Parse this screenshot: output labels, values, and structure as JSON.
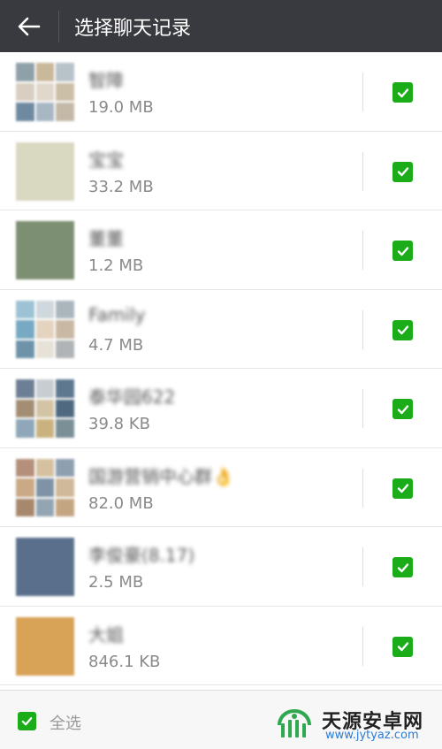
{
  "header": {
    "title": "选择聊天记录"
  },
  "chats": [
    {
      "name": "智障",
      "size": "19.0 MB",
      "checked": true,
      "grid": 3,
      "colors": [
        "#8fa0a8",
        "#c9b89a",
        "#b7c2c9",
        "#d8cfc2",
        "#e0d8cc",
        "#cbbfa8",
        "#6f8aa0",
        "#a7b7c3",
        "#c4b9a7"
      ]
    },
    {
      "name": "宝宝",
      "size": "33.2 MB",
      "checked": true,
      "grid": 1,
      "colors": [
        "#d9d8c1"
      ]
    },
    {
      "name": "董董",
      "size": "1.2 MB",
      "checked": true,
      "grid": 1,
      "colors": [
        "#7d8f72"
      ]
    },
    {
      "name": "Family",
      "size": "4.7 MB",
      "checked": true,
      "grid": 3,
      "colors": [
        "#9dc2d4",
        "#cfd8dc",
        "#aab6bc",
        "#77a9c2",
        "#e3d3bf",
        "#c9b8a4",
        "#6e93a8",
        "#e6e2d8",
        "#b0b4b6"
      ]
    },
    {
      "name": "泰华园622",
      "size": "39.8 KB",
      "checked": true,
      "grid": 3,
      "colors": [
        "#6c7f95",
        "#c8cdd2",
        "#5e7890",
        "#a38e74",
        "#d3c4a5",
        "#4f6a80",
        "#8fa7b8",
        "#c9b27f",
        "#7b8f97"
      ]
    },
    {
      "name": "国游营销中心群👌",
      "size": "82.0 MB",
      "checked": true,
      "grid": 3,
      "colors": [
        "#b48f7a",
        "#d5c0a0",
        "#8e9fb0",
        "#c9a986",
        "#7e93a6",
        "#d0b89a",
        "#a7886d",
        "#93a5b2",
        "#c4a582"
      ]
    },
    {
      "name": "李俊豪(8.17)",
      "size": "2.5 MB",
      "checked": true,
      "grid": 1,
      "colors": [
        "#5a6f8c"
      ]
    },
    {
      "name": "大姐",
      "size": "846.1 KB",
      "checked": true,
      "grid": 1,
      "colors": [
        "#d8a257"
      ]
    }
  ],
  "footer": {
    "select_all": "全选",
    "checked": true
  },
  "watermark": {
    "title": "天源安卓网",
    "url": "www.jytyaz.com"
  },
  "colors": {
    "topbar": "#393a3f",
    "accent": "#1aad19"
  }
}
